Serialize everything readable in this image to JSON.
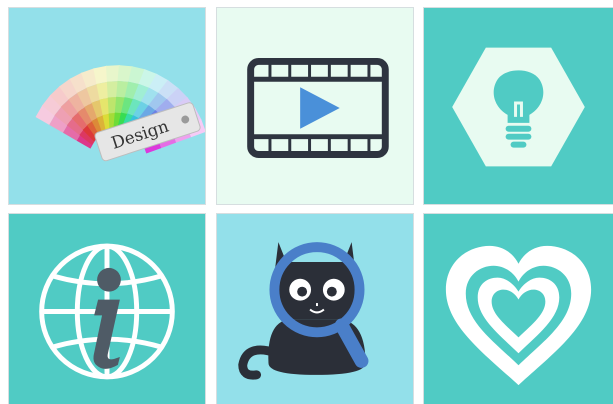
{
  "tiles": [
    {
      "icon": "color-swatch-fan-icon",
      "bg": "#93e0ea",
      "label": "Design"
    },
    {
      "icon": "film-play-icon",
      "bg": "#e8fbf1"
    },
    {
      "icon": "lightbulb-hexagon-icon",
      "bg": "#50cbc4"
    },
    {
      "icon": "globe-info-icon",
      "bg": "#50cbc4"
    },
    {
      "icon": "cat-magnifier-icon",
      "bg": "#93e0ea"
    },
    {
      "icon": "nested-heart-icon",
      "bg": "#50cbc4"
    }
  ],
  "colors": {
    "teal": "#50cbc4",
    "light_cyan": "#93e0ea",
    "mint": "#e8fbf1",
    "dark": "#2e3440",
    "blue": "#4a90d9"
  }
}
